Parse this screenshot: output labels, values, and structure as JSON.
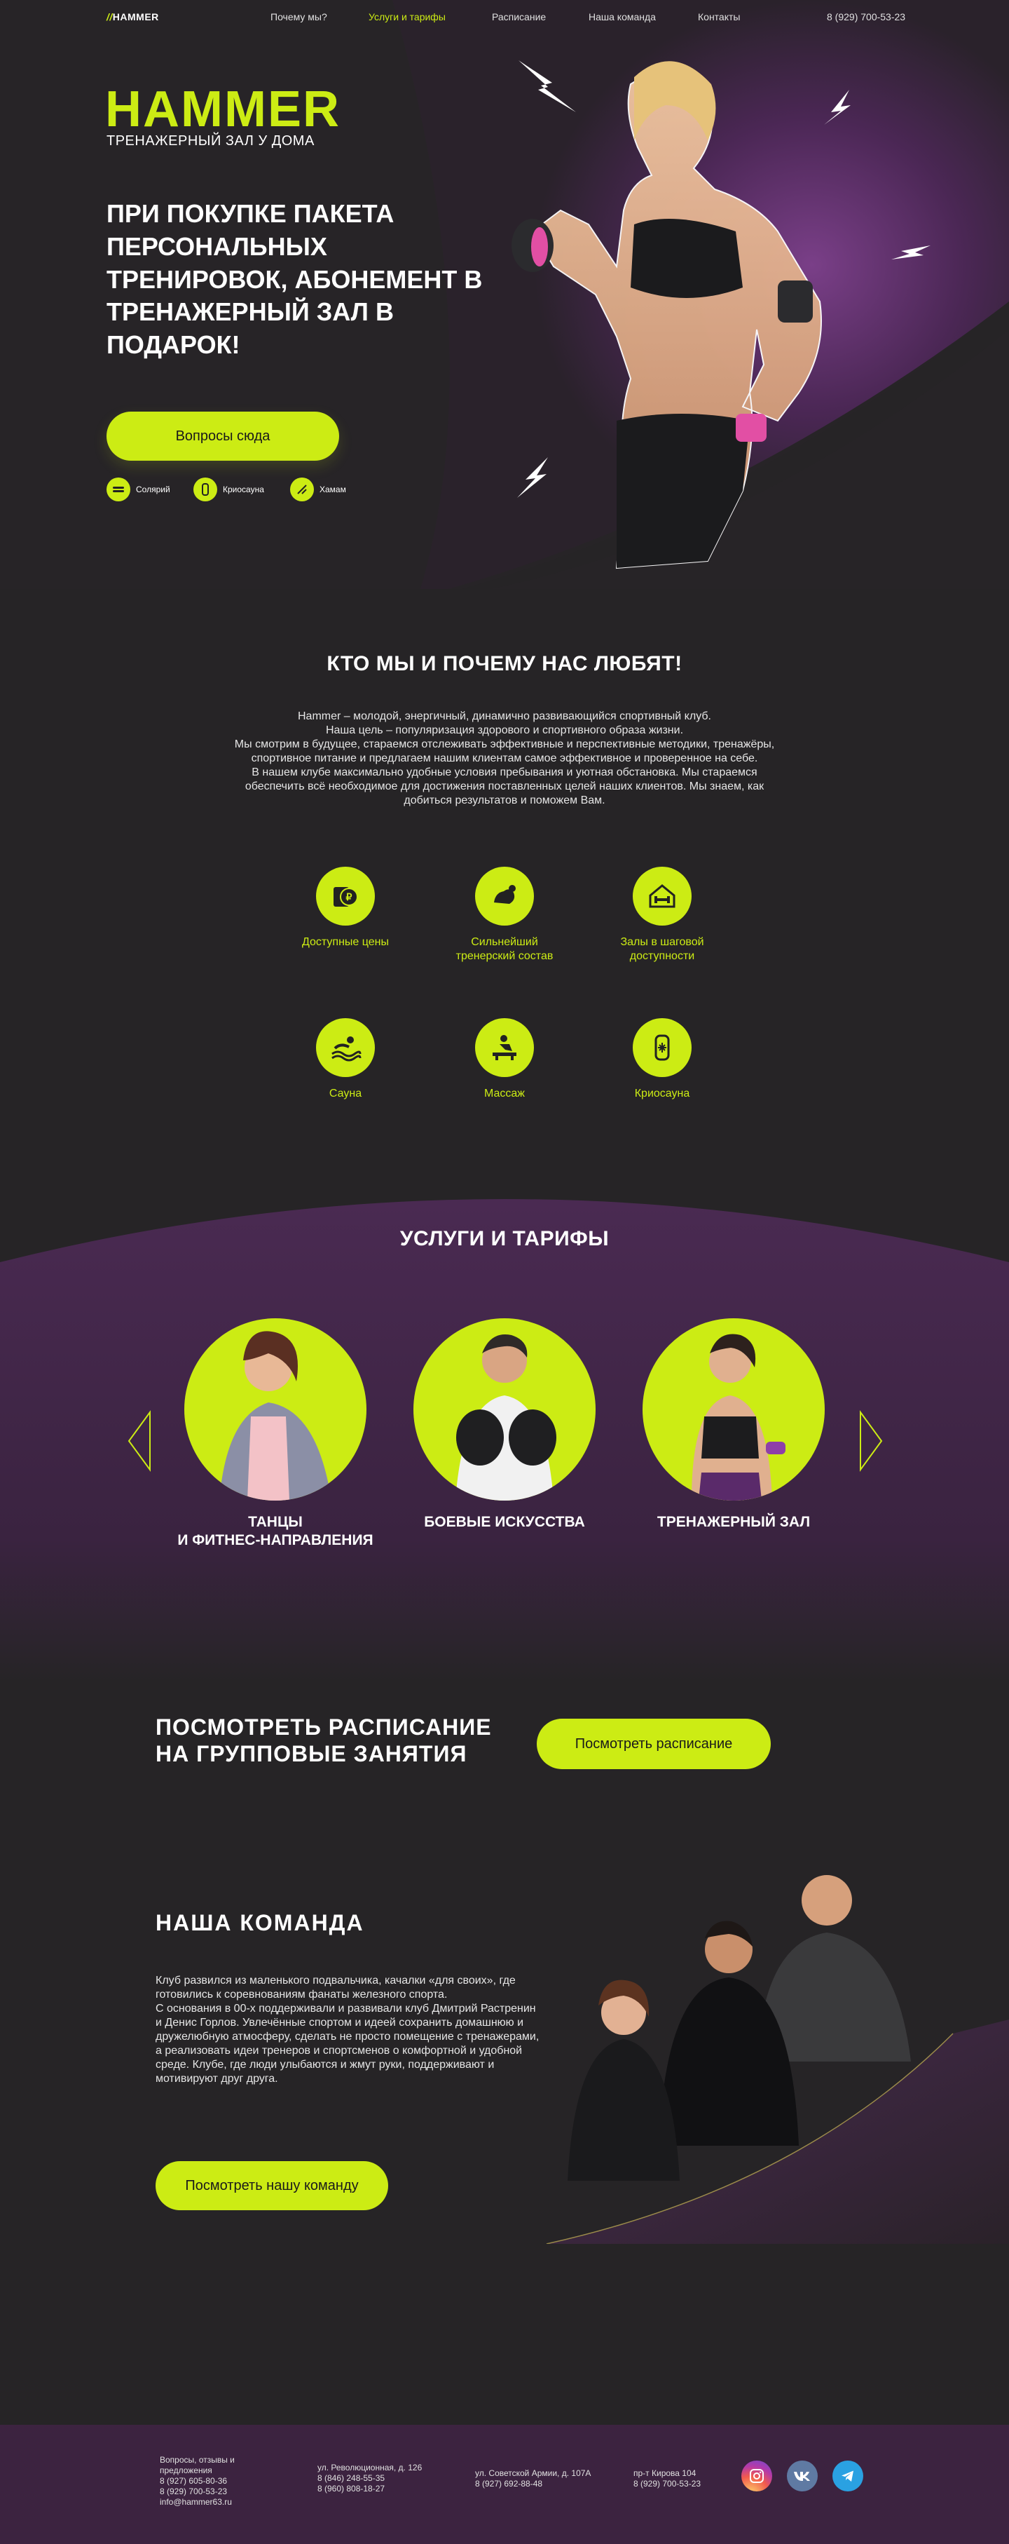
{
  "colors": {
    "accent": "#ccec14",
    "background": "#262426",
    "purple": "#3c2340"
  },
  "nav": {
    "logo": "HAMMER",
    "links": [
      "Почему мы?",
      "Услуги и тарифы",
      "Расписание",
      "Наша команда",
      "Контакты"
    ],
    "active_index": 1,
    "phone": "8 (929) 700-53-23"
  },
  "hero": {
    "logo": "HAMMER",
    "subtitle": "ТРЕНАЖЕРНЫЙ ЗАЛ У ДОМА",
    "title": "ПРИ ПОКУПКЕ ПАКЕТА ПЕРСОНАЛЬНЫХ ТРЕНИРОВОК, АБОНЕМЕНТ В ТРЕНАЖЕРНЫЙ ЗАЛ В ПОДАРОК!",
    "button": "Вопросы сюда",
    "features": [
      {
        "label": "Солярий",
        "icon": "tanning-icon"
      },
      {
        "label": "Криосауна",
        "icon": "cryosauna-icon"
      },
      {
        "label": "Хамам",
        "icon": "hammam-icon"
      }
    ]
  },
  "about": {
    "title": "КТО МЫ И ПОЧЕМУ НАС ЛЮБЯТ!",
    "lines": [
      "Hammer – молодой, энергичный, динамично развивающийся спортивный клуб.",
      "Наша цель – популяризация здорового и спортивного образа жизни.",
      "Мы смотрим в будущее, стараемся отслеживать эффективные и перспективные методики, тренажёры,",
      "спортивное питание и предлагаем нашим клиентам самое эффективное и проверенное на себе.",
      "В нашем клубе максимально удобные условия пребывания и уютная обстановка. Мы стараемся",
      "обеспечить всё необходимое для достижения поставленных целей наших клиентов. Мы знаем, как",
      "добиться результатов и поможем Вам."
    ],
    "advantages": [
      {
        "label": "Доступные цены",
        "icon": "price-icon"
      },
      {
        "label": "Сильнейший тренерский состав",
        "icon": "strength-icon"
      },
      {
        "label": "Залы в шаговой доступности",
        "icon": "home-gym-icon"
      },
      {
        "label": "Сауна",
        "icon": "sauna-icon"
      },
      {
        "label": "Массаж",
        "icon": "massage-icon"
      },
      {
        "label": "Криосауна",
        "icon": "cryo-icon"
      }
    ]
  },
  "services": {
    "title": "УСЛУГИ И ТАРИФЫ",
    "items": [
      {
        "label_line1": "ТАНЦЫ",
        "label_line2": "И ФИТНЕС-НАПРАВЛЕНИЯ"
      },
      {
        "label_line1": "БОЕВЫЕ ИСКУССТВА",
        "label_line2": ""
      },
      {
        "label_line1": "ТРЕНАЖЕРНЫЙ ЗАЛ",
        "label_line2": ""
      }
    ]
  },
  "schedule": {
    "title_line1": "ПОСМОТРЕТЬ РАСПИСАНИЕ",
    "title_line2": "НА ГРУППОВЫЕ ЗАНЯТИЯ",
    "button": "Посмотреть расписание"
  },
  "team": {
    "title": "НАША КОМАНДА",
    "paragraphs": [
      "Клуб развился из маленького подвальчика, качалки «для своих», где готовились к соревнованиям фанаты железного спорта.",
      "С основания в 00-х поддерживали и развивали клуб Дмитрий Растренин и Денис Горлов. Увлечённые спортом и идеей сохранить домашнюю и дружелюбную атмосферу, сделать не просто помещение с тренажерами, а реализовать идеи тренеров и спортсменов о комфортной и удобной среде. Клубе, где люди улыбаются и жмут руки, поддерживают и мотивируют друг друга."
    ],
    "button": "Посмотреть нашу команду"
  },
  "footer": {
    "col1": [
      "Вопросы, отзывы и",
      "предложения",
      "8 (927) 605-80-36",
      "8 (929) 700-53-23",
      "info@hammer63.ru"
    ],
    "col2": [
      "ул. Революционная, д. 126",
      "8 (846) 248-55-35",
      "8 (960) 808-18-27"
    ],
    "col3": [
      "ул. Советской Армии, д. 107А",
      "8 (927) 692-88-48"
    ],
    "col4": [
      "пр-т Кирова 104",
      "8 (929) 700-53-23"
    ],
    "social": [
      "instagram-icon",
      "vk-icon",
      "telegram-icon"
    ]
  }
}
